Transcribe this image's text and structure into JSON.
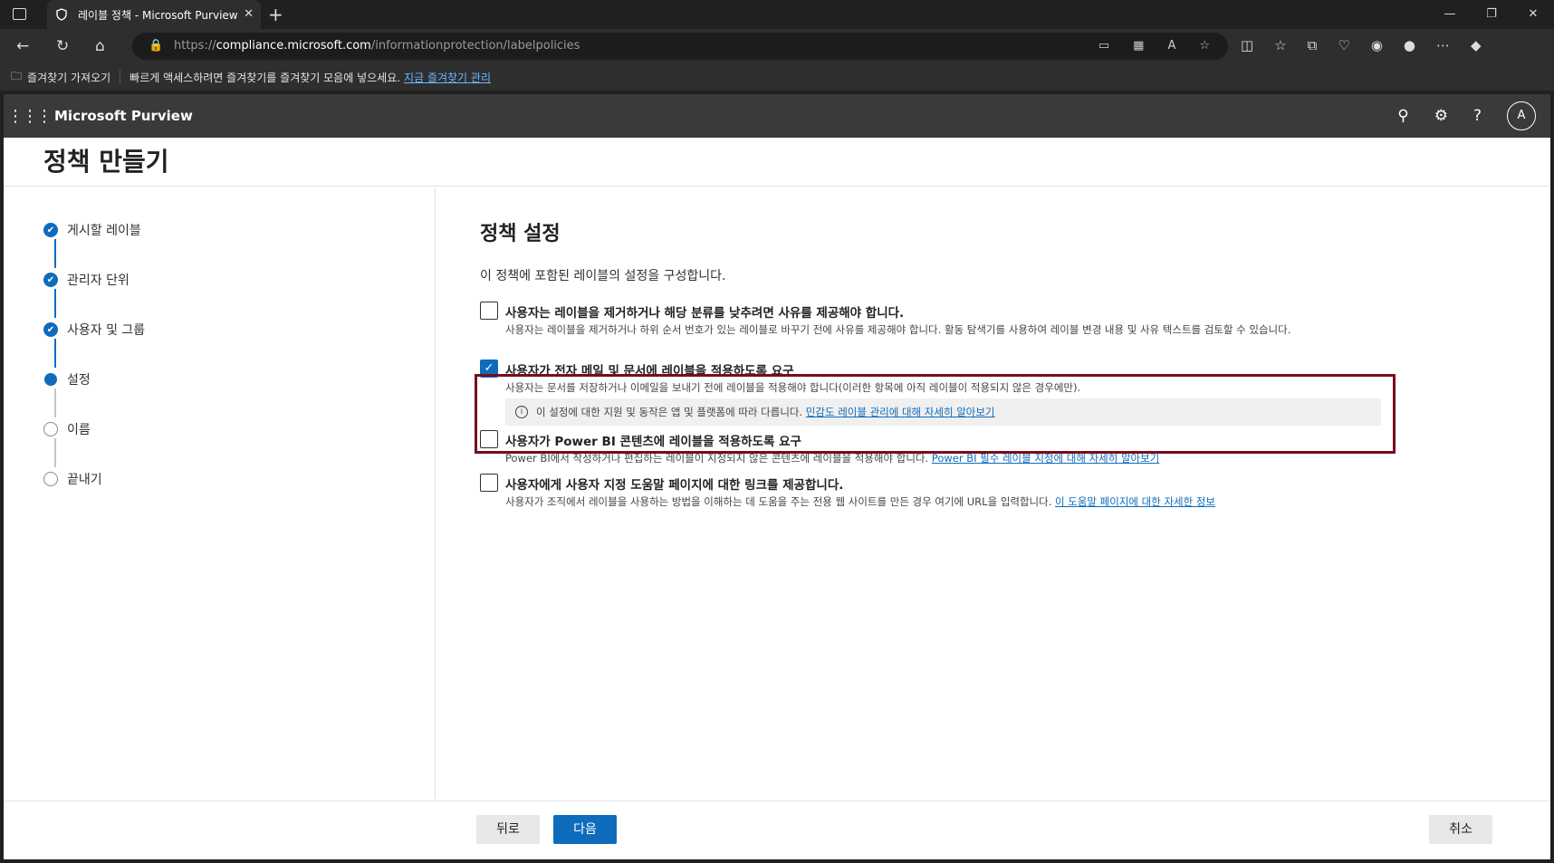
{
  "browser": {
    "tab_title": "레이블 정책 - Microsoft Purview",
    "url_prefix": "https://",
    "url_host": "compliance.microsoft.com",
    "url_path": "/informationprotection/labelpolicies",
    "bookmarks_import": "즐겨찾기 가져오기",
    "bookmarks_hint": "빠르게 액세스하려면 즐겨찾기를 즐겨찾기 모음에 넣으세요.",
    "bookmarks_manage": "지금 즐겨찾기 관리"
  },
  "app": {
    "brand": "Microsoft Purview",
    "avatar_initial": "A"
  },
  "page": {
    "title": "정책 만들기"
  },
  "steps": [
    {
      "label": "게시할 레이블",
      "status": "done"
    },
    {
      "label": "관리자 단위",
      "status": "done"
    },
    {
      "label": "사용자 및 그룹",
      "status": "done"
    },
    {
      "label": "설정",
      "status": "current"
    },
    {
      "label": "이름",
      "status": "todo"
    },
    {
      "label": "끝내기",
      "status": "todo"
    }
  ],
  "main": {
    "heading": "정책 설정",
    "description": "이 정책에 포함된 레이블의 설정을 구성합니다.",
    "options": [
      {
        "title": "사용자는 레이블을 제거하거나 해당 분류를 낮추려면 사유를 제공해야 합니다.",
        "sub": "사용자는 레이블을 제거하거나 하위 순서 번호가 있는 레이블로 바꾸기 전에 사유를 제공해야 합니다. 활동 탐색기를 사용하여 레이블 변경 내용 및 사유 텍스트를 검토할 수 있습니다.",
        "checked": false
      },
      {
        "title": "사용자가 전자 메일 및 문서에 레이블을 적용하도록 요구",
        "sub": "사용자는 문서를 저장하거나 이메일을 보내기 전에 레이블을 적용해야 합니다(이러한 항목에 아직 레이블이 적용되지 않은 경우에만).",
        "info": "이 설정에 대한 지원 및 동작은 앱 및 플랫폼에 따라 다릅니다.",
        "info_link": "민감도 레이블 관리에 대해 자세히 알아보기",
        "checked": true
      },
      {
        "title": "사용자가 Power BI 콘텐츠에 레이블을 적용하도록 요구",
        "sub": "Power BI에서 작성하거나 편집하는 레이블이 지정되지 않은 콘텐츠에 레이블을 적용해야 합니다.",
        "link": "Power BI 필수 레이블 지정에 대해 자세히 알아보기",
        "checked": false
      },
      {
        "title": "사용자에게 사용자 지정 도움말 페이지에 대한 링크를 제공합니다.",
        "sub": "사용자가 조직에서 레이블을 사용하는 방법을 이해하는 데 도움을 주는 전용 웹 사이트를 만든 경우 여기에 URL을 입력합니다.",
        "link": "이 도움말 페이지에 대한 자세한 정보",
        "checked": false
      }
    ]
  },
  "footer": {
    "back": "뒤로",
    "next": "다음",
    "cancel": "취소"
  },
  "colors": {
    "accent": "#0f6cbd",
    "highlight_border": "#7a0c1d",
    "header_bg": "#3b3a39"
  }
}
